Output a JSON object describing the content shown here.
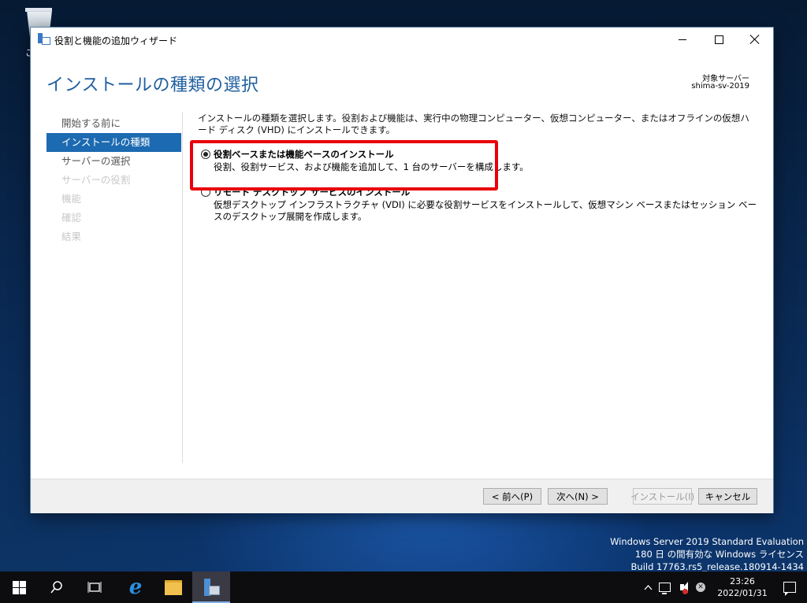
{
  "desktop": {
    "icon_caption": "ご"
  },
  "window": {
    "title": "役割と機能の追加ウィザード",
    "page_title": "インストールの種類の選択",
    "destination_label": "対象サーバー",
    "destination_server": "shima-sv-2019"
  },
  "nav": {
    "items": [
      {
        "label": "開始する前に",
        "state": "normal"
      },
      {
        "label": "インストールの種類",
        "state": "active"
      },
      {
        "label": "サーバーの選択",
        "state": "normal"
      },
      {
        "label": "サーバーの役割",
        "state": "disabled"
      },
      {
        "label": "機能",
        "state": "disabled"
      },
      {
        "label": "確認",
        "state": "disabled"
      },
      {
        "label": "結果",
        "state": "disabled"
      }
    ]
  },
  "content": {
    "intro": "インストールの種類を選択します。役割および機能は、実行中の物理コンピューター、仮想コンピューター、またはオフラインの仮想ハード ディスク (VHD) にインストールできます。",
    "options": [
      {
        "title": "役割ベースまたは機能ベースのインストール",
        "desc": "役割、役割サービス、および機能を追加して、1 台のサーバーを構成します。",
        "selected": true
      },
      {
        "title": "リモート デスクトップ サービスのインストール",
        "desc": "仮想デスクトップ インフラストラクチャ (VDI) に必要な役割サービスをインストールして、仮想マシン ベースまたはセッション ベースのデスクトップ展開を作成します。",
        "selected": false
      }
    ],
    "highlight_color": "#e8000b"
  },
  "buttons": {
    "prev": "< 前へ(P)",
    "next": "次へ(N) >",
    "install": "インストール(I)",
    "cancel": "キャンセル"
  },
  "watermark": {
    "line1": "Windows Server 2019 Standard Evaluation",
    "line2": "180 日 の間有効な Windows ライセンス",
    "line3": "Build 17763.rs5_release.180914-1434"
  },
  "taskbar": {
    "icons": [
      "windows-start-icon",
      "search-icon",
      "task-view-icon",
      "internet-explorer-icon",
      "file-explorer-icon",
      "server-manager-icon"
    ],
    "time": "23:26",
    "date": "2022/01/31"
  },
  "colors": {
    "accent": "#1c6ab1",
    "title_blue": "#1f5f9f"
  }
}
